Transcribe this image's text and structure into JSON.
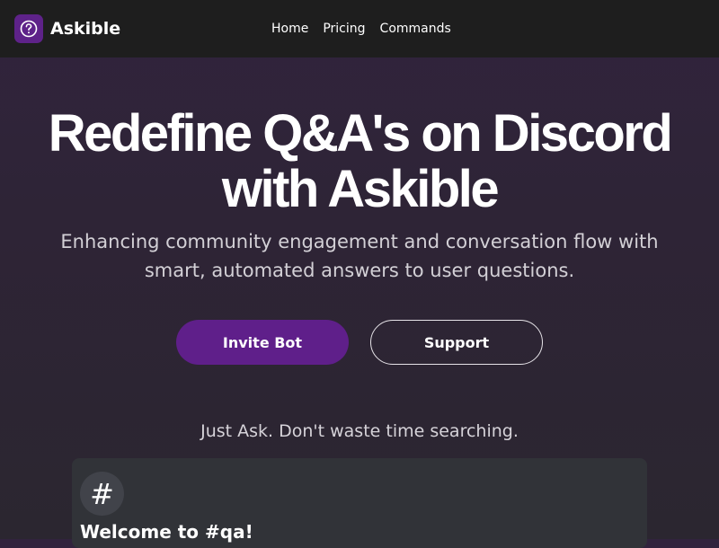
{
  "nav": {
    "brand_name": "Askible",
    "logo_icon": "question-circle-icon",
    "links": [
      "Home",
      "Pricing",
      "Commands"
    ]
  },
  "hero": {
    "title_line1": "Redefine Q&A's on Discord",
    "title_line2": "with Askible",
    "subtitle": "Enhancing community engagement and conversation flow with smart, automated answers to user questions.",
    "invite_button": "Invite Bot",
    "support_button": "Support"
  },
  "tagline": "Just Ask. Don't waste time searching.",
  "channel_preview": {
    "icon": "#",
    "welcome_text": "Welcome to #qa!"
  },
  "colors": {
    "accent": "#5f1f8a",
    "navbar": "#1e1e1e",
    "background": "#2e2436",
    "card": "#313338"
  }
}
